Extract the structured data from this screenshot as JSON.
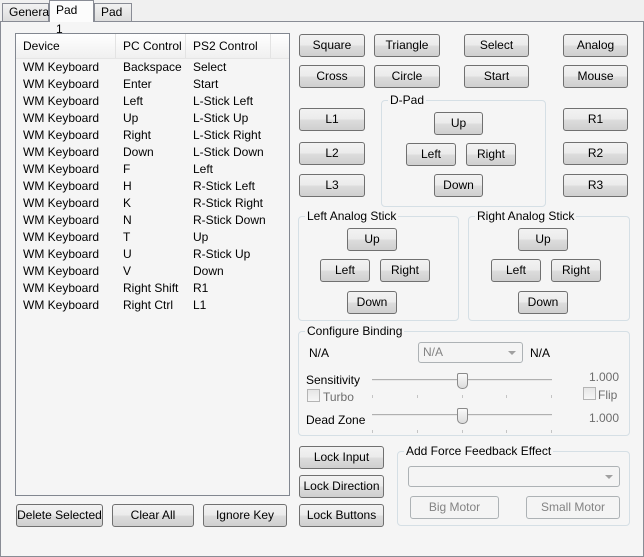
{
  "tabs": [
    {
      "label": "General",
      "active": false
    },
    {
      "label": "Pad 1",
      "active": true
    },
    {
      "label": "Pad 2",
      "active": false
    }
  ],
  "bindings_list": {
    "columns": [
      "Device",
      "PC Control",
      "PS2 Control"
    ],
    "rows": [
      [
        "WM Keyboard",
        "Backspace",
        "Select"
      ],
      [
        "WM Keyboard",
        "Enter",
        "Start"
      ],
      [
        "WM Keyboard",
        "Left",
        "L-Stick Left"
      ],
      [
        "WM Keyboard",
        "Up",
        "L-Stick Up"
      ],
      [
        "WM Keyboard",
        "Right",
        "L-Stick Right"
      ],
      [
        "WM Keyboard",
        "Down",
        "L-Stick Down"
      ],
      [
        "WM Keyboard",
        "F",
        "Left"
      ],
      [
        "WM Keyboard",
        "H",
        "R-Stick Left"
      ],
      [
        "WM Keyboard",
        "K",
        "R-Stick Right"
      ],
      [
        "WM Keyboard",
        "N",
        "R-Stick Down"
      ],
      [
        "WM Keyboard",
        "T",
        "Up"
      ],
      [
        "WM Keyboard",
        "U",
        "R-Stick Up"
      ],
      [
        "WM Keyboard",
        "V",
        "Down"
      ],
      [
        "WM Keyboard",
        "Right Shift",
        "R1"
      ],
      [
        "WM Keyboard",
        "Right Ctrl",
        "L1"
      ]
    ]
  },
  "list_buttons": {
    "delete_selected": "Delete Selected",
    "clear_all": "Clear All",
    "ignore_key": "Ignore Key"
  },
  "face_buttons": {
    "square": "Square",
    "triangle": "Triangle",
    "select": "Select",
    "analog": "Analog",
    "cross": "Cross",
    "circle": "Circle",
    "start": "Start",
    "mouse": "Mouse"
  },
  "shoulder_buttons": {
    "l1": "L1",
    "l2": "L2",
    "l3": "L3",
    "r1": "R1",
    "r2": "R2",
    "r3": "R3"
  },
  "dpad": {
    "title": "D-Pad",
    "up": "Up",
    "left": "Left",
    "right": "Right",
    "down": "Down"
  },
  "left_stick": {
    "title": "Left Analog Stick",
    "up": "Up",
    "left": "Left",
    "right": "Right",
    "down": "Down"
  },
  "right_stick": {
    "title": "Right Analog Stick",
    "up": "Up",
    "left": "Left",
    "right": "Right",
    "down": "Down"
  },
  "configure_binding": {
    "title": "Configure Binding",
    "left_label": "N/A",
    "combo_value": "N/A",
    "right_label": "N/A",
    "sensitivity_label": "Sensitivity",
    "sensitivity_value": "1.000",
    "sensitivity_position": 0.5,
    "turbo_label": "Turbo",
    "turbo_checked": false,
    "flip_label": "Flip",
    "flip_checked": false,
    "deadzone_label": "Dead Zone",
    "deadzone_value": "1.000",
    "deadzone_position": 0.5
  },
  "lock_buttons": {
    "lock_input": "Lock Input",
    "lock_direction": "Lock Direction",
    "lock_buttons": "Lock Buttons"
  },
  "force_feedback": {
    "title": "Add Force Feedback Effect",
    "combo_value": "",
    "big_motor": "Big Motor",
    "small_motor": "Small Motor"
  }
}
